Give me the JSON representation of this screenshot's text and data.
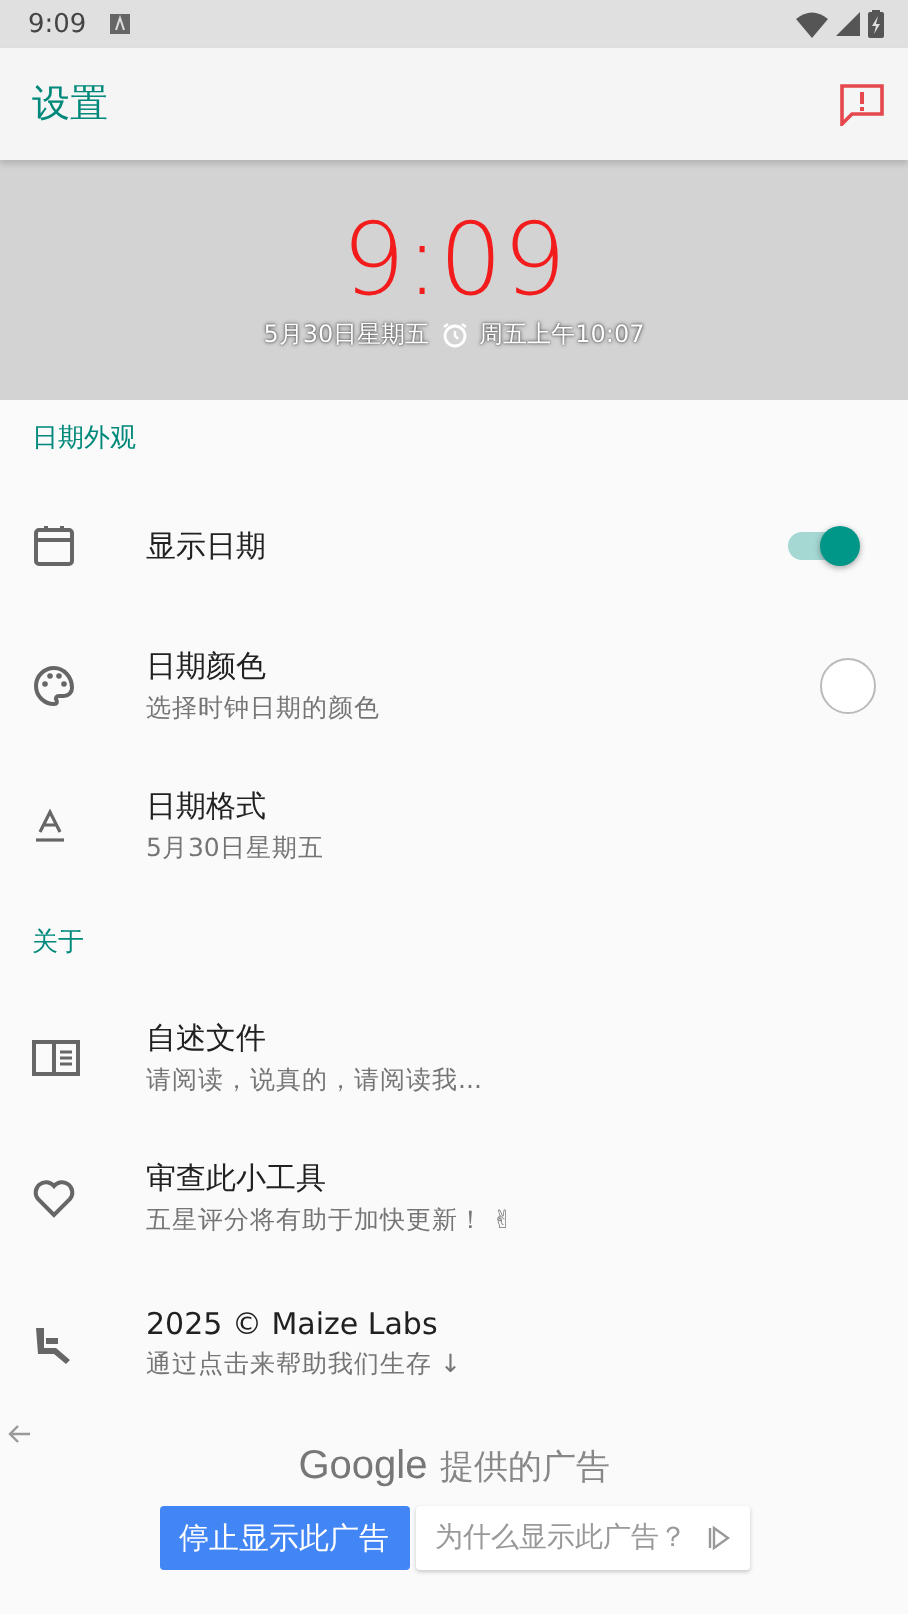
{
  "status_bar": {
    "time": "9:09"
  },
  "app_bar": {
    "title": "设置"
  },
  "clock": {
    "time": "9:09",
    "date": "5月30日星期五",
    "alarm": "周五上午10:07"
  },
  "sections": [
    {
      "title": "日期外观",
      "items": [
        {
          "kind": "toggle",
          "title": "显示日期",
          "on": true
        },
        {
          "kind": "color",
          "title": "日期颜色",
          "subtitle": "选择时钟日期的颜色",
          "color": "#ffffff"
        },
        {
          "kind": "plain",
          "title": "日期格式",
          "subtitle": "5月30日星期五"
        }
      ]
    },
    {
      "title": "关于",
      "items": [
        {
          "kind": "plain",
          "title": "自述文件",
          "subtitle": "请阅读，说真的，请阅读我..."
        },
        {
          "kind": "plain",
          "title": "审查此小工具",
          "subtitle": "五星评分将有助于加快更新！ ✌"
        },
        {
          "kind": "plain",
          "title": "2025 © Maize Labs",
          "subtitle": "通过点击来帮助我们生存 ↓"
        }
      ]
    }
  ],
  "ad": {
    "brand": "Google",
    "caption": "提供的广告",
    "stop_button": "停止显示此广告",
    "why_button": "为什么显示此广告？"
  }
}
